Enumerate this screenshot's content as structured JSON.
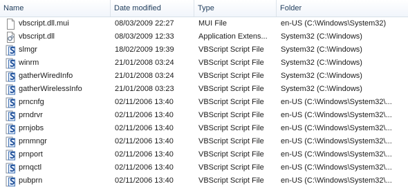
{
  "columns": {
    "name": "Name",
    "date": "Date modified",
    "type": "Type",
    "folder": "Folder"
  },
  "files": [
    {
      "name": "vbscript.dll.mui",
      "date": "08/03/2009 22:27",
      "type": "MUI File",
      "folder": "en-US (C:\\Windows\\System32)",
      "icon": "document-icon"
    },
    {
      "name": "vbscript.dll",
      "date": "08/03/2009 12:33",
      "type": "Application Extens...",
      "folder": "System32 (C:\\Windows)",
      "icon": "dll-icon"
    },
    {
      "name": "slmgr",
      "date": "18/02/2009 19:39",
      "type": "VBScript Script File",
      "folder": "System32 (C:\\Windows)",
      "icon": "vbscript-icon"
    },
    {
      "name": "winrm",
      "date": "21/01/2008 03:24",
      "type": "VBScript Script File",
      "folder": "System32 (C:\\Windows)",
      "icon": "vbscript-icon"
    },
    {
      "name": "gatherWiredInfo",
      "date": "21/01/2008 03:24",
      "type": "VBScript Script File",
      "folder": "System32 (C:\\Windows)",
      "icon": "vbscript-icon"
    },
    {
      "name": "gatherWirelessInfo",
      "date": "21/01/2008 03:23",
      "type": "VBScript Script File",
      "folder": "System32 (C:\\Windows)",
      "icon": "vbscript-icon"
    },
    {
      "name": "prncnfg",
      "date": "02/11/2006 13:40",
      "type": "VBScript Script File",
      "folder": "en-US (C:\\Windows\\System32\\...",
      "icon": "vbscript-icon"
    },
    {
      "name": "prndrvr",
      "date": "02/11/2006 13:40",
      "type": "VBScript Script File",
      "folder": "en-US (C:\\Windows\\System32\\...",
      "icon": "vbscript-icon"
    },
    {
      "name": "prnjobs",
      "date": "02/11/2006 13:40",
      "type": "VBScript Script File",
      "folder": "en-US (C:\\Windows\\System32\\...",
      "icon": "vbscript-icon"
    },
    {
      "name": "prnmngr",
      "date": "02/11/2006 13:40",
      "type": "VBScript Script File",
      "folder": "en-US (C:\\Windows\\System32\\...",
      "icon": "vbscript-icon"
    },
    {
      "name": "prnport",
      "date": "02/11/2006 13:40",
      "type": "VBScript Script File",
      "folder": "en-US (C:\\Windows\\System32\\...",
      "icon": "vbscript-icon"
    },
    {
      "name": "prnqctl",
      "date": "02/11/2006 13:40",
      "type": "VBScript Script File",
      "folder": "en-US (C:\\Windows\\System32\\...",
      "icon": "vbscript-icon"
    },
    {
      "name": "pubprn",
      "date": "02/11/2006 13:40",
      "type": "VBScript Script File",
      "folder": "en-US (C:\\Windows\\System32\\...",
      "icon": "vbscript-icon"
    }
  ]
}
